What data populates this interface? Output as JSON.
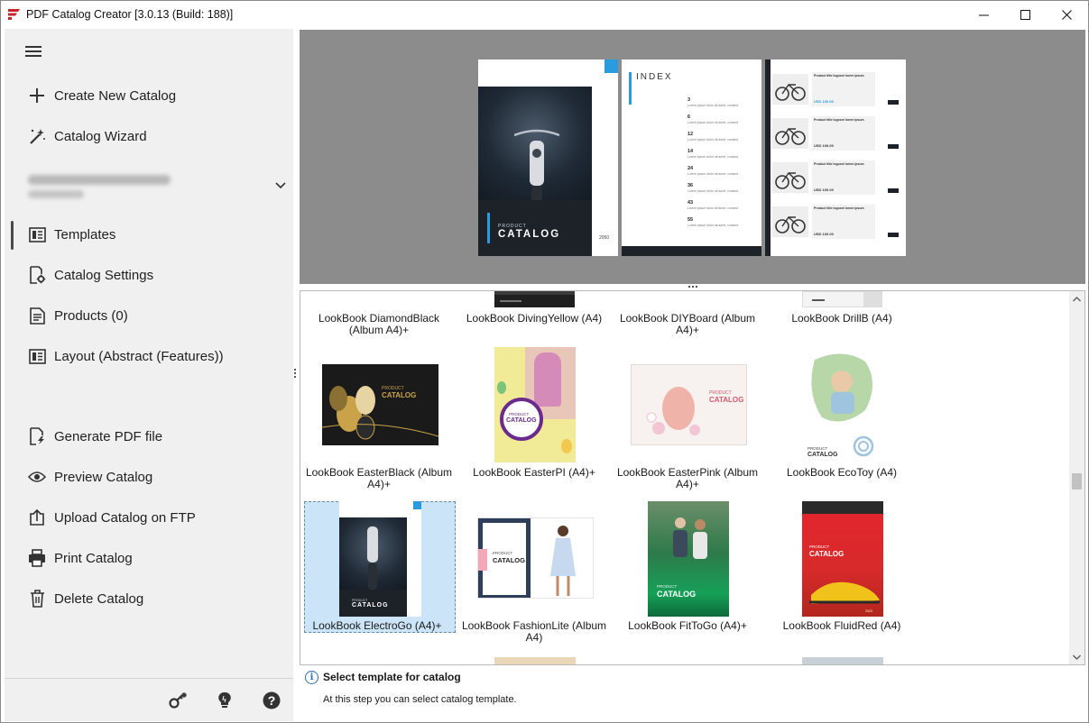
{
  "window": {
    "title": "PDF Catalog Creator [3.0.13 (Build: 188)]",
    "minimize": "—",
    "maximize": "☐",
    "close": "✕"
  },
  "sidebar": {
    "menu_icon": "hamburger-icon",
    "top_items": [
      {
        "label": "Create New Catalog",
        "icon": "plus-icon"
      },
      {
        "label": "Catalog Wizard",
        "icon": "magic-wand-icon"
      }
    ],
    "catalog_items": [
      {
        "label": "Templates",
        "icon": "template-icon",
        "active": true
      },
      {
        "label": "Catalog Settings",
        "icon": "settings-document-icon"
      },
      {
        "label": "Products (0)",
        "icon": "document-icon"
      },
      {
        "label": "Layout (Abstract (Features))",
        "icon": "layout-icon"
      }
    ],
    "action_items": [
      {
        "label": "Generate PDF file",
        "icon": "generate-file-icon"
      },
      {
        "label": "Preview Catalog",
        "icon": "eye-icon"
      },
      {
        "label": "Upload Catalog on FTP",
        "icon": "upload-icon"
      },
      {
        "label": "Print Catalog",
        "icon": "printer-icon"
      },
      {
        "label": "Delete Catalog",
        "icon": "trash-icon"
      }
    ],
    "footer_icons": [
      "key-icon",
      "lightbulb-icon",
      "help-icon"
    ]
  },
  "preview": {
    "cover_small": "PRODUCT",
    "cover_big": "CATALOG",
    "cover_year": "2050",
    "index_title": "INDEX",
    "index_pages": [
      "3",
      "6",
      "12",
      "14",
      "24",
      "36",
      "43",
      "55"
    ],
    "index_sub": "Lorem ipsum dolor sit amet, consect",
    "product_title": "Product title logoset lorem ipsum",
    "product_price": "USD 100.00"
  },
  "templates": {
    "row0": [
      {
        "label": "LookBook DiamondBlack (Album A4)+"
      },
      {
        "label": "LookBook DivingYellow (A4)"
      },
      {
        "label": "LookBook DIYBoard (Album A4)+"
      },
      {
        "label": "LookBook DrillB (A4)"
      }
    ],
    "row1": [
      {
        "label": "LookBook EasterBlack (Album A4)+",
        "thumb_small": "PRODUCT",
        "thumb_big": "CATALOG"
      },
      {
        "label": "LookBook EasterPI (A4)+",
        "thumb_small": "PRODUCT",
        "thumb_big": "CATALOG"
      },
      {
        "label": "LookBook EasterPink (Album A4)+",
        "thumb_small": "PRODUCT",
        "thumb_big": "CATALOG"
      },
      {
        "label": "LookBook EcoToy (A4)",
        "thumb_small": "PRODUCT",
        "thumb_big": "CATALOG"
      }
    ],
    "row2": [
      {
        "label": "LookBook ElectroGo (A4)+",
        "thumb_small": "PRODUCT",
        "thumb_big": "CATALOG",
        "selected": true
      },
      {
        "label": "LookBook FashionLite (Album A4)",
        "thumb_small": "PRODUCT",
        "thumb_big": "CATALOG"
      },
      {
        "label": "LookBook FitToGo (A4)+",
        "thumb_small": "PRODUCT",
        "thumb_big": "CATALOG"
      },
      {
        "label": "LookBook FluidRed (A4)",
        "thumb_small": "PRODUCT",
        "thumb_big": "CATALOG",
        "year": "2023"
      }
    ]
  },
  "hint": {
    "icon": "info-icon",
    "title": "Select template for catalog",
    "text": "At this step you can select catalog template."
  }
}
